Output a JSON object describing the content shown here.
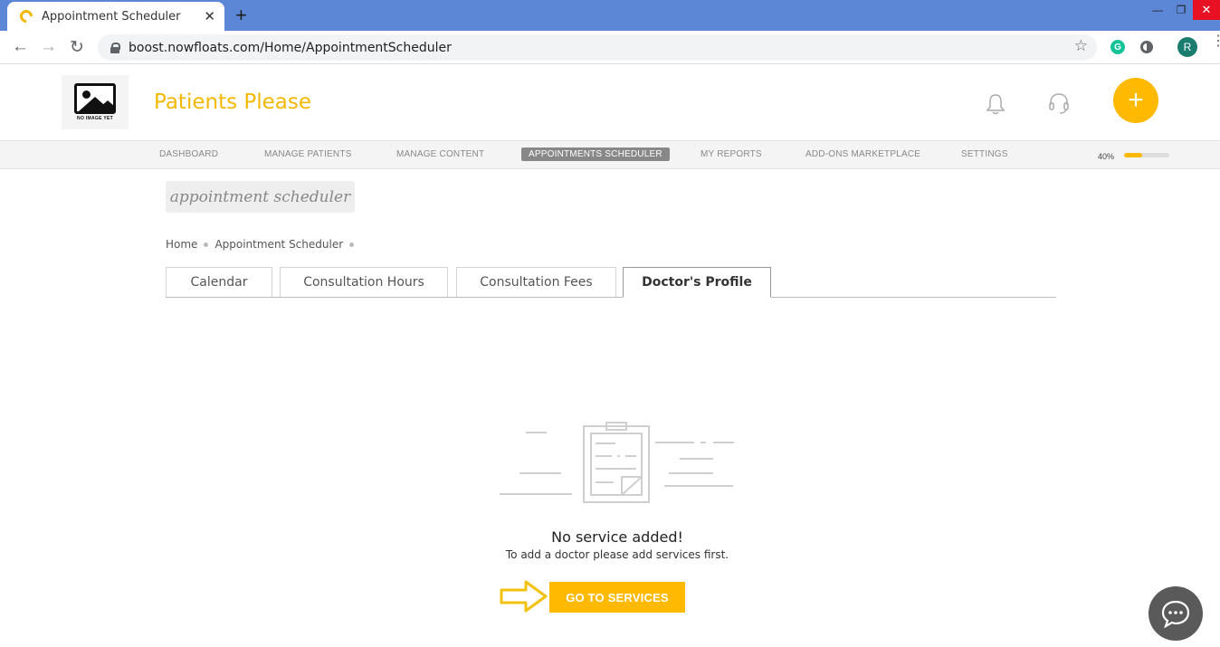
{
  "browser": {
    "tab_title": "Appointment Scheduler",
    "tab_close": "✕",
    "new_tab": "+",
    "url": "boost.nowfloats.com/Home/AppointmentScheduler",
    "profile_initial": "R",
    "extension_initial": "G"
  },
  "header": {
    "logo_caption": "NO IMAGE YET",
    "site_name": "Patients Please",
    "add_symbol": "+"
  },
  "nav": {
    "items": [
      "DASHBOARD",
      "MANAGE PATIENTS",
      "MANAGE CONTENT",
      "APPOINTMENTS SCHEDULER",
      "MY REPORTS",
      "ADD-ONS MARKETPLACE",
      "SETTINGS"
    ],
    "active_index": 3,
    "progress_label": "40%",
    "progress_value": 0.4
  },
  "page": {
    "title": "appointment scheduler",
    "breadcrumb": [
      "Home",
      "Appointment Scheduler"
    ]
  },
  "tabs": [
    "Calendar",
    "Consultation Hours",
    "Consultation Fees",
    "Doctor's Profile"
  ],
  "empty_state": {
    "title": "No service added!",
    "subtitle": "To add a doctor please add services first.",
    "button": "GO TO SERVICES"
  },
  "colors": {
    "accent": "#ffb900",
    "brand_text": "#f5b800",
    "browser_bar": "#5b87d6"
  }
}
